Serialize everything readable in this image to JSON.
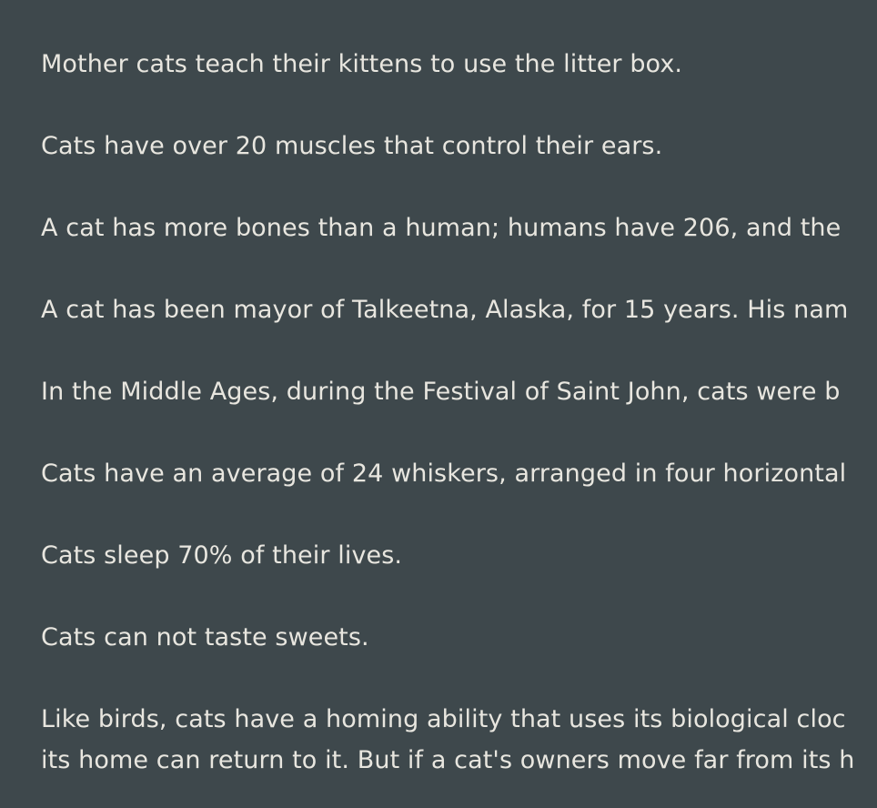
{
  "facts": [
    {
      "text": "Mother cats teach their kittens to use the litter box."
    },
    {
      "text": "Cats have over 20 muscles that control their ears."
    },
    {
      "text": "A cat has more bones than a human; humans have 206, and the"
    },
    {
      "text": "A cat has been mayor of Talkeetna, Alaska, for 15 years. His nam"
    },
    {
      "text": "In the Middle Ages, during the Festival of Saint John, cats were b"
    },
    {
      "text": "Cats have an average of 24 whiskers, arranged in four horizontal"
    },
    {
      "text": "Cats sleep 70% of their lives."
    },
    {
      "text": "Cats can not taste sweets."
    },
    {
      "lines": [
        "Like birds, cats have a homing ability that uses its biological cloc",
        "its home can return to it. But if a cat's owners move far from its h"
      ]
    }
  ]
}
